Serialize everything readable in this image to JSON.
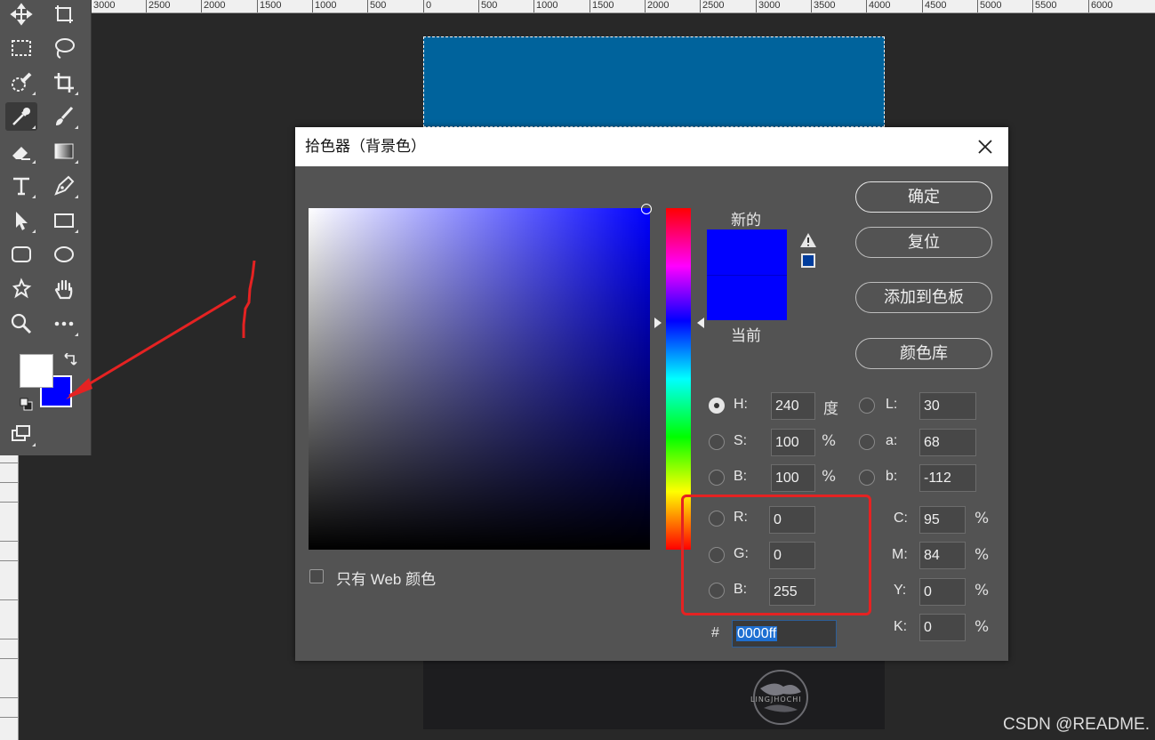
{
  "ruler": {
    "top_ticks": [
      "3000",
      "2500",
      "2000",
      "1500",
      "1000",
      "500",
      "0",
      "500",
      "1000",
      "1500",
      "2000",
      "2500",
      "3000",
      "3500",
      "4000",
      "4500",
      "5000",
      "5500",
      "6000"
    ],
    "left_ticks": [
      "0",
      "4",
      "0",
      "0",
      "4",
      "5",
      "0",
      "0",
      "5",
      "0",
      "0",
      "5",
      "5",
      "0",
      "0"
    ]
  },
  "toolbar": {
    "tools": [
      "move-tool",
      "artboard-tool",
      "rect-marquee-tool",
      "lasso-tool",
      "quick-select-tool",
      "crop-tool",
      "eyedropper-tool",
      "brush-tool",
      "eraser-tool",
      "gradient-tool",
      "type-tool",
      "pen-tool",
      "path-select-tool",
      "rectangle-tool",
      "rounded-rect-tool",
      "ellipse-tool",
      "custom-shape-tool",
      "hand-tool",
      "zoom-tool",
      "more-tools"
    ],
    "foreground_color": "#ffffff",
    "background_color": "#0000ff",
    "active_tool": "eyedropper-tool"
  },
  "dialog": {
    "title": "拾色器（背景色）",
    "buttons": {
      "ok": "确定",
      "reset": "复位",
      "add_swatch": "添加到色板",
      "color_library": "颜色库"
    },
    "preview": {
      "new_label": "新的",
      "current_label": "当前",
      "new_color": "#0000ff",
      "current_color": "#0000ff",
      "gamut_warning_icon": "warning-triangle-icon",
      "web_safe_swatch_color": "#003c9c"
    },
    "web_only_label": "只有 Web 颜色",
    "field_colors": {
      "selected_hue": "#0000ff"
    },
    "hsb": {
      "h_label": "H:",
      "h_value": "240",
      "h_unit": "度",
      "s_label": "S:",
      "s_value": "100",
      "s_unit": "%",
      "b_label": "B:",
      "b_value": "100",
      "b_unit": "%"
    },
    "rgb": {
      "r_label": "R:",
      "r_value": "0",
      "g_label": "G:",
      "g_value": "0",
      "b_label": "B:",
      "b_value": "255"
    },
    "lab": {
      "l_label": "L:",
      "l_value": "30",
      "a_label": "a:",
      "a_value": "68",
      "b_label": "b:",
      "b_value": "-112"
    },
    "cmyk": {
      "c_label": "C:",
      "c_value": "95",
      "c_unit": "%",
      "m_label": "M:",
      "m_value": "84",
      "m_unit": "%",
      "y_label": "Y:",
      "y_value": "0",
      "y_unit": "%",
      "k_label": "K:",
      "k_value": "0",
      "k_unit": "%"
    },
    "hex": {
      "label": "#",
      "value": "0000ff"
    }
  },
  "annotation": {
    "highlight_color": "#e52222"
  },
  "canvas_logo_text": "LINGJHOCHI",
  "watermark": "CSDN @README."
}
